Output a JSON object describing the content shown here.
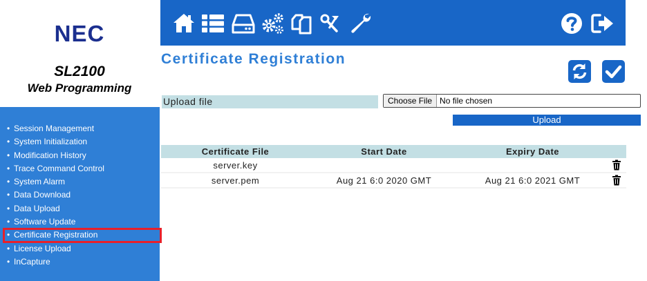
{
  "brand": {
    "logo": "NEC",
    "model": "SL2100",
    "subtitle": "Web Programming"
  },
  "toolbar": {
    "icons": [
      "home-icon",
      "list-icon",
      "drive-icon",
      "gears-icon",
      "copy-icon",
      "tools-icon",
      "wrench-icon",
      "help-icon",
      "logout-icon"
    ],
    "color": "#1866c7"
  },
  "sidebar": {
    "items": [
      {
        "label": "Session Management"
      },
      {
        "label": "System Initialization"
      },
      {
        "label": "Modification History"
      },
      {
        "label": "Trace Command Control"
      },
      {
        "label": "System Alarm"
      },
      {
        "label": "Data Download"
      },
      {
        "label": "Data Upload"
      },
      {
        "label": "Software Update"
      },
      {
        "label": "Certificate Registration"
      },
      {
        "label": "License Upload"
      },
      {
        "label": "InCapture"
      }
    ],
    "active_index": 8
  },
  "main": {
    "title": "Certificate Registration",
    "upload_label": "Upload file",
    "file_button": "Choose File",
    "file_text": "No file chosen",
    "upload_button": "Upload",
    "table": {
      "headers": [
        "Certificate File",
        "Start Date",
        "Expiry Date"
      ],
      "rows": [
        {
          "file": "server.key",
          "start": "",
          "expiry": ""
        },
        {
          "file": "server.pem",
          "start": "Aug 21 6:0 2020 GMT",
          "expiry": "Aug 21 6:0 2021 GMT"
        }
      ]
    }
  }
}
